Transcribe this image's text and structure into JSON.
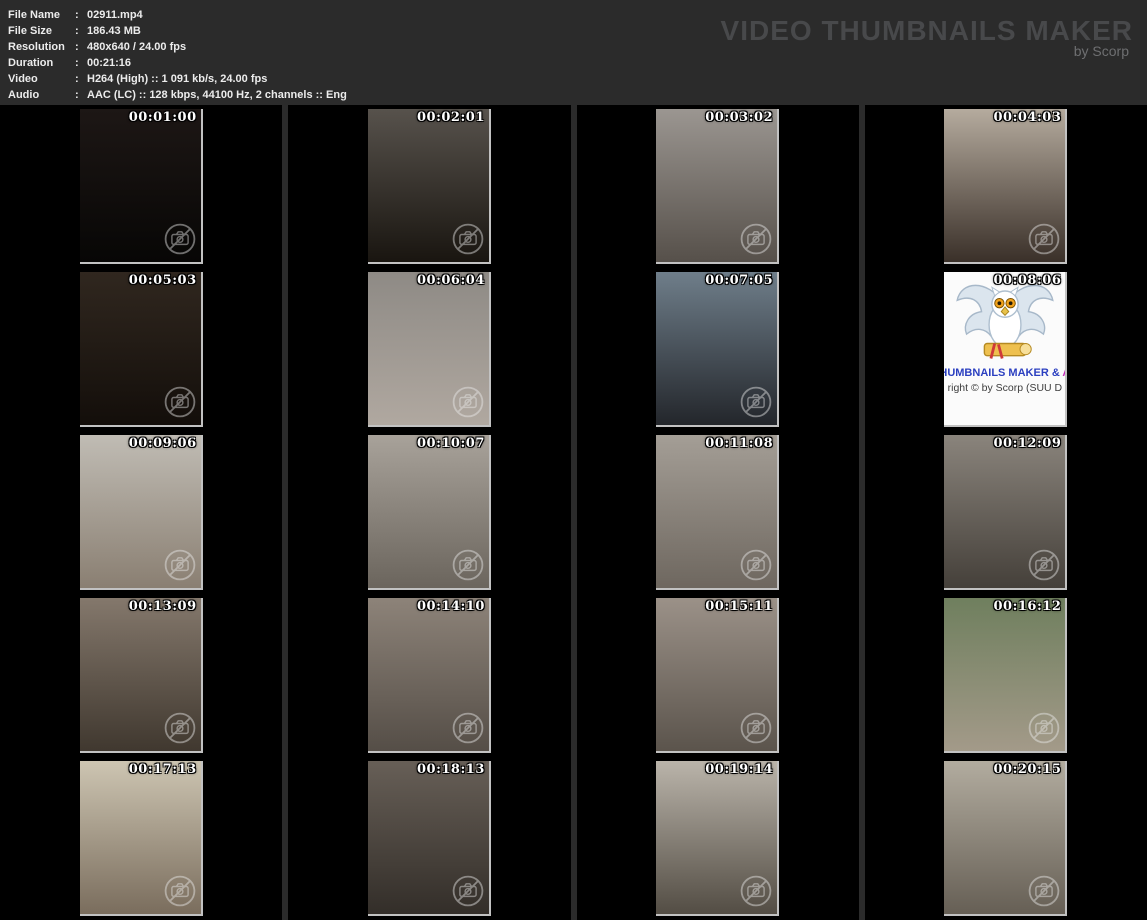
{
  "header": {
    "fields": [
      {
        "label": "File Name",
        "value": "02911.mp4"
      },
      {
        "label": "File Size",
        "value": "186.43 MB"
      },
      {
        "label": "Resolution",
        "value": "480x640 / 24.00 fps"
      },
      {
        "label": "Duration",
        "value": "00:21:16"
      },
      {
        "label": "Video",
        "value": "H264 (High) :: 1 091 kb/s, 24.00 fps"
      },
      {
        "label": "Audio",
        "value": "AAC (LC) :: 128 kbps, 44100 Hz, 2 channels :: Eng"
      }
    ],
    "colon": ":",
    "brand_title": "VIDEO THUMBNAILS MAKER",
    "brand_subtitle": "by Scorp"
  },
  "colors": {
    "page_background": "#2b2b2b",
    "cell_background": "#000000",
    "brand_title": "#48494b",
    "brand_subtitle": "#6e6f71",
    "timestamp_text": "#ffffff",
    "thumbnail_edge": "#c2c2c2",
    "logo_text_blue": "#2b3fc0",
    "logo_text_magenta": "#c32bb8"
  },
  "grid": {
    "columns": 4,
    "rows": 5,
    "thumbnails": [
      {
        "timestamp": "00:01:00",
        "tone_top": "#1d1715",
        "tone_bottom": "#070605"
      },
      {
        "timestamp": "00:02:01",
        "tone_top": "#57524c",
        "tone_bottom": "#191510"
      },
      {
        "timestamp": "00:03:02",
        "tone_top": "#9b9691",
        "tone_bottom": "#56504a"
      },
      {
        "timestamp": "00:04:03",
        "tone_top": "#b5ab9e",
        "tone_bottom": "#3a3029"
      },
      {
        "timestamp": "00:05:03",
        "tone_top": "#30271f",
        "tone_bottom": "#130e0a"
      },
      {
        "timestamp": "00:06:04",
        "tone_top": "#8e8a85",
        "tone_bottom": "#b0a8a0"
      },
      {
        "timestamp": "00:07:05",
        "tone_top": "#6f7e8a",
        "tone_bottom": "#23262b"
      },
      {
        "timestamp": "00:08:06",
        "type": "logo",
        "logo_title": "HUMBNAILS MAKER &",
        "logo_title_accent": "A",
        "logo_copyright": "right © by Scorp (SUU D"
      },
      {
        "timestamp": "00:09:06",
        "tone_top": "#c0bcb4",
        "tone_bottom": "#8a7f72"
      },
      {
        "timestamp": "00:10:07",
        "tone_top": "#a8a29a",
        "tone_bottom": "#6b655d"
      },
      {
        "timestamp": "00:11:08",
        "tone_top": "#a49e96",
        "tone_bottom": "#6e675f"
      },
      {
        "timestamp": "00:12:09",
        "tone_top": "#8a847c",
        "tone_bottom": "#45403a"
      },
      {
        "timestamp": "00:13:09",
        "tone_top": "#84786c",
        "tone_bottom": "#40382f"
      },
      {
        "timestamp": "00:14:10",
        "tone_top": "#8d8379",
        "tone_bottom": "#554e47"
      },
      {
        "timestamp": "00:15:11",
        "tone_top": "#9b9188",
        "tone_bottom": "#5b544c"
      },
      {
        "timestamp": "00:16:12",
        "tone_top": "#6f7f5e",
        "tone_bottom": "#a39a89"
      },
      {
        "timestamp": "00:17:13",
        "tone_top": "#cdc5b2",
        "tone_bottom": "#7a6d5d"
      },
      {
        "timestamp": "00:18:13",
        "tone_top": "#675f57",
        "tone_bottom": "#332e29"
      },
      {
        "timestamp": "00:19:14",
        "tone_top": "#bab4aa",
        "tone_bottom": "#534d44"
      },
      {
        "timestamp": "00:20:15",
        "tone_top": "#b2ac9f",
        "tone_bottom": "#665f55"
      }
    ]
  }
}
